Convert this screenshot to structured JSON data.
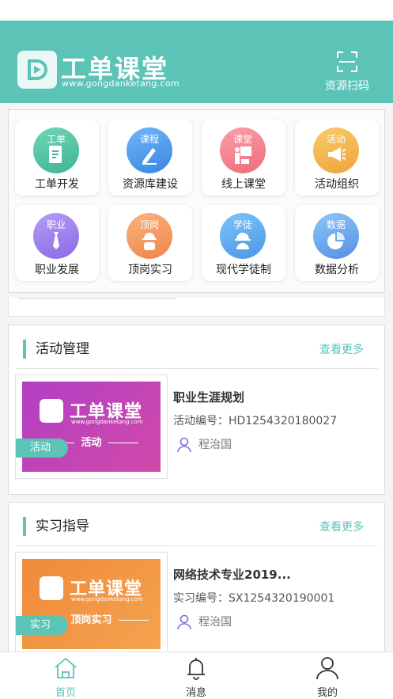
{
  "app": {
    "brand_name": "工单课堂",
    "brand_url": "www.gongdanketang.com",
    "scan_label": "资源扫码"
  },
  "grid": {
    "items": [
      {
        "circle_text": "工单",
        "label": "工单开发",
        "icon": "document-icon",
        "color_from": "#6fd6b4",
        "color_to": "#3fb597"
      },
      {
        "circle_text": "课程",
        "label": "资源库建设",
        "icon": "pen-icon",
        "color_from": "#6fb6f6",
        "color_to": "#3a86e3"
      },
      {
        "circle_text": "课堂",
        "label": "线上课堂",
        "icon": "teacher-board-icon",
        "color_from": "#f9a0a8",
        "color_to": "#ee6c78"
      },
      {
        "circle_text": "活动",
        "label": "活动组织",
        "icon": "megaphone-icon",
        "color_from": "#f7cc6a",
        "color_to": "#f0a33a"
      },
      {
        "circle_text": "职业",
        "label": "职业发展",
        "icon": "tie-icon",
        "color_from": "#b59cf6",
        "color_to": "#8a6ae8"
      },
      {
        "circle_text": "顶岗",
        "label": "顶岗实习",
        "icon": "worker-icon",
        "color_from": "#f9b481",
        "color_to": "#ef8548"
      },
      {
        "circle_text": "学徒",
        "label": "现代学徒制",
        "icon": "helmet-icon",
        "color_from": "#7fc3f7",
        "color_to": "#4a97e6"
      },
      {
        "circle_text": "数据",
        "label": "数据分析",
        "icon": "pie-chart-icon",
        "color_from": "#8cc6f5",
        "color_to": "#5590e6"
      }
    ]
  },
  "activity": {
    "section_title": "活动管理",
    "more_label": "查看更多",
    "badge": "活动",
    "thumb_brand": "工单课堂",
    "thumb_url": "www.gongdanketang.com",
    "thumb_sub": "活动",
    "title": "职业生涯规划",
    "code": "活动编号：HD1254320180027",
    "person": "程治国",
    "color_from": "#b23fc4",
    "color_to": "#d14aa9"
  },
  "internship": {
    "section_title": "实习指导",
    "more_label": "查看更多",
    "badge": "实习",
    "thumb_brand": "工单课堂",
    "thumb_url": "www.gongdanketang.com",
    "thumb_sub": "顶岗实习",
    "title": "网络技术专业2019...",
    "code": "实习编号：SX1254320190001",
    "person": "程治国",
    "color_from": "#f08a3b",
    "color_to": "#f4a34e"
  },
  "tabbar": {
    "items": [
      {
        "label": "首页",
        "icon": "home-icon",
        "active": true
      },
      {
        "label": "消息",
        "icon": "bell-icon",
        "active": false
      },
      {
        "label": "我的",
        "icon": "user-icon",
        "active": false
      }
    ],
    "active_color": "#5cc3b7",
    "inactive_color": "#333333"
  }
}
